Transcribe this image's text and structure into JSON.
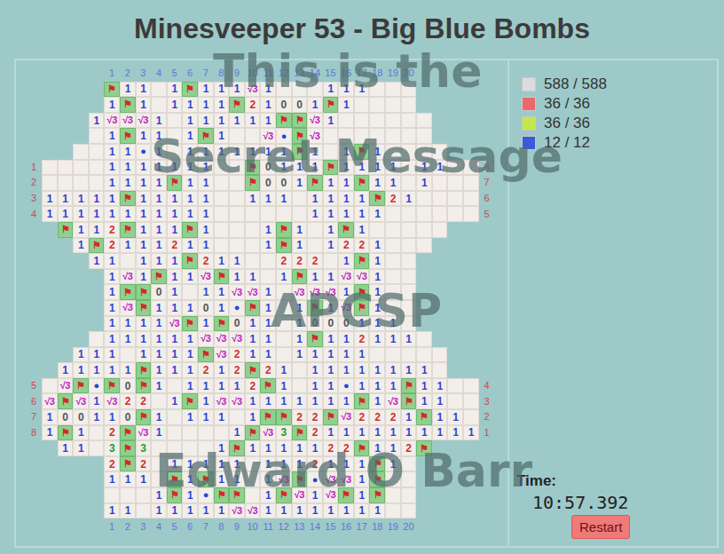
{
  "title": "Minesveeper 53 - Big Blue Bombs",
  "column_labels": [
    "1",
    "2",
    "3",
    "4",
    "5",
    "6",
    "7",
    "8",
    "9",
    "10",
    "11",
    "12",
    "13",
    "14",
    "15",
    "16",
    "17",
    "18",
    "19",
    "20"
  ],
  "rows": [
    {
      "left": "",
      "right": "",
      "cells": [
        null,
        null,
        null,
        null,
        "⚑",
        "1",
        "1",
        "",
        "1",
        "⚑",
        "1",
        "1",
        "1",
        "√3",
        "1",
        "",
        "",
        "",
        "1",
        "1",
        "1",
        "",
        "",
        "",
        null,
        null,
        null,
        null
      ]
    },
    {
      "left": "",
      "right": "",
      "cells": [
        null,
        null,
        null,
        null,
        "1",
        "⚑",
        "1",
        "",
        "1",
        "1",
        "1",
        "1",
        "⚑",
        "2",
        "1",
        "0",
        "0",
        "1",
        "⚑",
        "1",
        "",
        "",
        "",
        "",
        null,
        null,
        null,
        null
      ]
    },
    {
      "left": "",
      "right": "",
      "cells": [
        null,
        null,
        null,
        "1",
        "√3",
        "√3",
        "√3",
        "1",
        "",
        "1",
        "1",
        "1",
        "1",
        "1",
        "1",
        "⚑",
        "⚑",
        "√3",
        "1",
        "",
        "",
        "",
        "",
        "",
        "",
        null,
        null,
        null
      ]
    },
    {
      "left": "",
      "right": "",
      "cells": [
        null,
        null,
        null,
        "",
        "1",
        "⚑",
        "1",
        "1",
        "",
        "1",
        "⚑",
        "1",
        "",
        "",
        "√3",
        "●",
        "⚑",
        "√3",
        "",
        "",
        "",
        "",
        "",
        "",
        "",
        null,
        null,
        null
      ]
    },
    {
      "left": "",
      "right": "",
      "cells": [
        null,
        null,
        "",
        "",
        "1",
        "1",
        "●",
        "1",
        "",
        "1",
        "1",
        "1",
        "1",
        "1",
        "1",
        "1",
        "⚑",
        "1",
        "",
        "1",
        "⚑",
        "1",
        "",
        "",
        "",
        "",
        null,
        null
      ]
    },
    {
      "left": "1",
      "right": "8",
      "cells": [
        "",
        "",
        "",
        "",
        "1",
        "1",
        "1",
        "1",
        "1",
        "1",
        "1",
        "",
        "",
        "⚑",
        "0",
        "1",
        "1",
        "1",
        "⚑",
        "1",
        "1",
        "1",
        "1",
        "",
        "1",
        "1",
        "",
        ""
      ]
    },
    {
      "left": "2",
      "right": "7",
      "cells": [
        "",
        "",
        "",
        "",
        "1",
        "1",
        "1",
        "1",
        "⚑",
        "1",
        "1",
        "",
        "",
        "⚑",
        "0",
        "0",
        "1",
        "⚑",
        "1",
        "1",
        "⚑",
        "1",
        "1",
        "",
        "1",
        "",
        "",
        ""
      ]
    },
    {
      "left": "3",
      "right": "6",
      "cells": [
        "1",
        "1",
        "1",
        "1",
        "1",
        "⚑",
        "1",
        "1",
        "1",
        "1",
        "1",
        "",
        "",
        "1",
        "1",
        "1",
        "",
        "1",
        "1",
        "1",
        "1",
        "⚑",
        "2",
        "1",
        "",
        "",
        "",
        ""
      ]
    },
    {
      "left": "4",
      "right": "5",
      "cells": [
        "1",
        "1",
        "1",
        "1",
        "1",
        "1",
        "1",
        "1",
        "1",
        "1",
        "1",
        "",
        "",
        "",
        "",
        "",
        "",
        "1",
        "1",
        "1",
        "1",
        "1",
        "",
        "",
        "",
        "",
        "",
        ""
      ]
    },
    {
      "left": "",
      "right": "",
      "cells": [
        null,
        "⚑",
        "1",
        "1",
        "2",
        "⚑",
        "1",
        "1",
        "1",
        "⚑",
        "1",
        "",
        "",
        "",
        "1",
        "⚑",
        "1",
        "",
        "1",
        "⚑",
        "1",
        "",
        "",
        "",
        "",
        "",
        null,
        null
      ]
    },
    {
      "left": "",
      "right": "",
      "cells": [
        null,
        null,
        "1",
        "⚑",
        "2",
        "1",
        "1",
        "1",
        "2",
        "1",
        "1",
        "",
        "",
        "",
        "1",
        "⚑",
        "1",
        "",
        "1",
        "2",
        "2",
        "1",
        "",
        "",
        "",
        null,
        null,
        null
      ]
    },
    {
      "left": "",
      "right": "",
      "cells": [
        null,
        null,
        null,
        "1",
        "1",
        "",
        "1",
        "1",
        "1",
        "⚑",
        "2",
        "1",
        "1",
        "",
        "",
        "2",
        "2",
        "2",
        "",
        "1",
        "⚑",
        "1",
        "",
        "",
        null,
        null,
        null,
        null
      ]
    },
    {
      "left": "",
      "right": "",
      "cells": [
        null,
        null,
        null,
        null,
        "1",
        "√3",
        "1",
        "⚑",
        "1",
        "1",
        "√3",
        "⚑",
        "1",
        "1",
        "",
        "1",
        "⚑",
        "1",
        "1",
        "√3",
        "√3",
        "1",
        "",
        "",
        null,
        null,
        null,
        null
      ]
    },
    {
      "left": "",
      "right": "",
      "cells": [
        null,
        null,
        null,
        null,
        "1",
        "⚑",
        "⚑",
        "0",
        "1",
        "",
        "1",
        "1",
        "√3",
        "√3",
        "1",
        "",
        "√3",
        "√3",
        "√3",
        "1",
        "⚑",
        "1",
        "",
        "",
        null,
        null,
        null,
        null
      ]
    },
    {
      "left": "",
      "right": "",
      "cells": [
        null,
        null,
        null,
        null,
        "1",
        "√3",
        "⚑",
        "1",
        "1",
        "1",
        "0",
        "1",
        "●",
        "⚑",
        "1",
        "",
        "1",
        "⚑",
        "1",
        "√3",
        "⚑",
        "1",
        "",
        "",
        null,
        null,
        null,
        null
      ]
    },
    {
      "left": "",
      "right": "",
      "cells": [
        null,
        null,
        null,
        null,
        "1",
        "1",
        "1",
        "1",
        "√3",
        "⚑",
        "1",
        "⚑",
        "0",
        "1",
        "1",
        "",
        "1",
        "0",
        "0",
        "0",
        "1",
        "1",
        "1",
        "",
        null,
        null,
        null,
        null
      ]
    },
    {
      "left": "",
      "right": "",
      "cells": [
        null,
        null,
        null,
        "",
        "1",
        "1",
        "1",
        "1",
        "1",
        "1",
        "√3",
        "√3",
        "√3",
        "1",
        "1",
        "",
        "1",
        "⚑",
        "1",
        "1",
        "2",
        "1",
        "1",
        "1",
        "",
        null,
        null,
        null
      ]
    },
    {
      "left": "",
      "right": "",
      "cells": [
        null,
        null,
        "1",
        "1",
        "1",
        "",
        "1",
        "1",
        "1",
        "1",
        "⚑",
        "√3",
        "2",
        "1",
        "1",
        "",
        "1",
        "1",
        "1",
        "1",
        "1",
        "",
        "",
        "",
        "",
        "",
        null,
        null
      ]
    },
    {
      "left": "",
      "right": "",
      "cells": [
        null,
        "1",
        "1",
        "1",
        "1",
        "1",
        "⚑",
        "1",
        "1",
        "1",
        "2",
        "1",
        "2",
        "⚑",
        "2",
        "1",
        "",
        "1",
        "1",
        "1",
        "1",
        "1",
        "1",
        "1",
        "1",
        "",
        null,
        null
      ]
    },
    {
      "left": "5",
      "right": "4",
      "cells": [
        "",
        "√3",
        "⚑",
        "●",
        "⚑",
        "0",
        "⚑",
        "1",
        "",
        "1",
        "1",
        "1",
        "1",
        "2",
        "⚑",
        "1",
        "",
        "1",
        "1",
        "●",
        "1",
        "1",
        "1",
        "⚑",
        "1",
        "1",
        "",
        ""
      ]
    },
    {
      "left": "6",
      "right": "3",
      "cells": [
        "√3",
        "⚑",
        "√3",
        "1",
        "√3",
        "2",
        "2",
        "",
        "1",
        "⚑",
        "1",
        "√3",
        "√3",
        "1",
        "1",
        "1",
        "1",
        "1",
        "1",
        "1",
        "⚑",
        "1",
        "√3",
        "⚑",
        "1",
        "1",
        "",
        ""
      ]
    },
    {
      "left": "7",
      "right": "2",
      "cells": [
        "1",
        "0",
        "0",
        "1",
        "1",
        "0",
        "⚑",
        "1",
        "",
        "1",
        "1",
        "1",
        "",
        "1",
        "⚑",
        "⚑",
        "2",
        "2",
        "⚑",
        "√3",
        "2",
        "2",
        "2",
        "1",
        "⚑",
        "1",
        "1",
        ""
      ]
    },
    {
      "left": "8",
      "right": "1",
      "cells": [
        "1",
        "⚑",
        "1",
        "",
        "2",
        "⚑",
        "√3",
        "1",
        "",
        "",
        "",
        "",
        "1",
        "⚑",
        "√3",
        "3",
        "⚑",
        "2",
        "1",
        "1",
        "1",
        "1",
        "1",
        "1",
        "1",
        "1",
        "1",
        "1"
      ]
    },
    {
      "left": "",
      "right": "",
      "cells": [
        null,
        "1",
        "1",
        "",
        "3",
        "⚑",
        "3",
        "",
        "",
        "",
        "",
        "1",
        "⚑",
        "1",
        "1",
        "1",
        "1",
        "1",
        "2",
        "2",
        "⚑",
        "1",
        "1",
        "2",
        "⚑",
        null,
        null,
        null
      ]
    },
    {
      "left": "",
      "right": "",
      "cells": [
        null,
        null,
        null,
        null,
        "2",
        "⚑",
        "2",
        "",
        "1",
        "1",
        "1",
        "1",
        "1",
        "",
        "1",
        "1",
        "1",
        "2",
        "1",
        "1",
        "1",
        "⚑",
        "1",
        "",
        null,
        null,
        null,
        null
      ]
    },
    {
      "left": "",
      "right": "",
      "cells": [
        null,
        null,
        null,
        null,
        "1",
        "1",
        "1",
        "",
        "⚑",
        "1",
        "⚑",
        "1",
        "1",
        "",
        "1",
        "√3",
        "⚑",
        "●",
        "√3",
        "√3",
        "1",
        "⚑",
        "",
        "",
        null,
        null,
        null,
        null
      ]
    },
    {
      "left": "",
      "right": "",
      "cells": [
        null,
        null,
        null,
        null,
        "",
        "",
        "",
        "1",
        "⚑",
        "1",
        "●",
        "⚑",
        "⚑",
        "",
        "1",
        "⚑",
        "√3",
        "1",
        "√3",
        "⚑",
        "1",
        "⚑",
        "",
        "",
        null,
        null,
        null,
        null
      ]
    },
    {
      "left": "",
      "right": "",
      "cells": [
        null,
        null,
        null,
        null,
        "1",
        "1",
        "",
        "1",
        "1",
        "1",
        "1",
        "1",
        "√3",
        "√3",
        "1",
        "1",
        "1",
        "1",
        "1",
        "1",
        "1",
        "1",
        "",
        "",
        null,
        null,
        null,
        null
      ]
    }
  ],
  "stats": [
    {
      "value": "588 / 588",
      "color": "#dcdcdc"
    },
    {
      "value": "36 / 36",
      "color": "#e86a6a"
    },
    {
      "value": "36 / 36",
      "color": "#c4e84a"
    },
    {
      "value": "12 / 12",
      "color": "#3a5ad8"
    }
  ],
  "timer": {
    "label": "Time:",
    "value": "10:57.392"
  },
  "restart": "Restart",
  "watermark": [
    "This is the",
    "Secret Message",
    "APCSP",
    "Edward O Barr"
  ]
}
